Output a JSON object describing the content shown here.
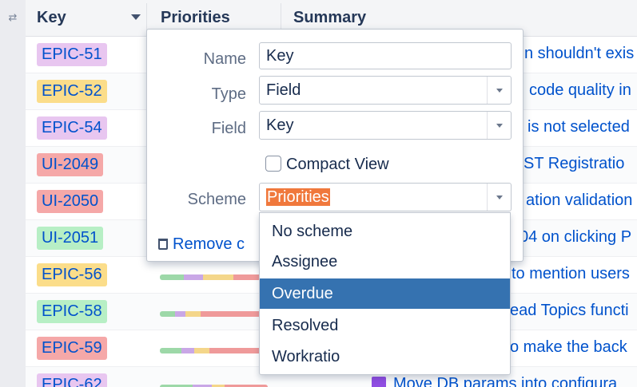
{
  "header": {
    "drag_glyph": "⇄",
    "key_label": "Key",
    "priorities_label": "Priorities",
    "summary_label": "Summary"
  },
  "rows": [
    {
      "key": "EPIC-51",
      "key_bg": "#e8c6f0",
      "summary": "n shouldn't exis"
    },
    {
      "key": "EPIC-52",
      "key_bg": "#fbdd8a",
      "summary": "code quality in"
    },
    {
      "key": "EPIC-54",
      "key_bg": "#e8c6f0",
      "summary": "is not selected"
    },
    {
      "key": "UI-2049",
      "key_bg": "#f5a8a8",
      "summary": "ST Registratio"
    },
    {
      "key": "UI-2050",
      "key_bg": "#f5a8a8",
      "summary": "ation validation"
    },
    {
      "key": "UI-2051",
      "key_bg": "#b7efc5",
      "summary": "04 on clicking P"
    },
    {
      "key": "EPIC-56",
      "key_bg": "#fbdd8a",
      "summary": "to mention users"
    },
    {
      "key": "EPIC-58",
      "key_bg": "#b7efc5",
      "summary": "ead Topics functi"
    },
    {
      "key": "EPIC-59",
      "key_bg": "#f5a8a8",
      "summary": "o make the back"
    },
    {
      "key": "EPIC-62",
      "key_bg": "#e8c6f0",
      "summary": "Move DB params into configura"
    }
  ],
  "colors": {
    "bar_green": "#9dd8a8",
    "bar_purple": "#c9a7e6",
    "bar_yellow": "#f4d68a",
    "bar_red": "#ef9a9a",
    "link": "#0052cc",
    "highlight": "#3572b0"
  },
  "popup": {
    "name_label": "Name",
    "name_value": "Key",
    "type_label": "Type",
    "type_value": "Field",
    "field_label": "Field",
    "field_value": "Key",
    "compact_view_label": "Compact View",
    "scheme_label": "Scheme",
    "scheme_value": "Priorities",
    "remove_label": "Remove c",
    "scheme_options": [
      "No scheme",
      "Assignee",
      "Overdue",
      "Resolved",
      "Workratio"
    ],
    "highlighted_option": "Overdue"
  },
  "icons": {
    "dropdown_caret": "caret-down-icon",
    "trash": "trash-icon",
    "story": "story-icon"
  }
}
